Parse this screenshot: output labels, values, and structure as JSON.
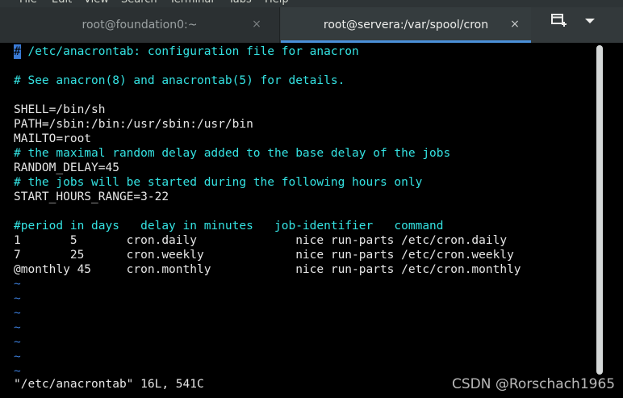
{
  "menu": {
    "items": [
      "File",
      "Edit",
      "View",
      "Search",
      "Terminal",
      "Tabs",
      "Help"
    ]
  },
  "tabs": [
    {
      "label": "root@foundation0:~",
      "active": false
    },
    {
      "label": "root@servera:/var/spool/cron",
      "active": true
    }
  ],
  "icons": {
    "tab_close": "×",
    "new_tab": "new-tab-icon",
    "menu": "chevron-down-icon"
  },
  "terminal": {
    "lines": [
      {
        "text": "# /etc/anacrontab: configuration file for anacron",
        "kind": "comment",
        "cursor_on_first_char": true
      },
      {
        "text": "",
        "kind": "normal"
      },
      {
        "text": "# See anacron(8) and anacrontab(5) for details.",
        "kind": "comment"
      },
      {
        "text": "",
        "kind": "normal"
      },
      {
        "text": "SHELL=/bin/sh",
        "kind": "normal"
      },
      {
        "text": "PATH=/sbin:/bin:/usr/sbin:/usr/bin",
        "kind": "normal"
      },
      {
        "text": "MAILTO=root",
        "kind": "normal"
      },
      {
        "text": "# the maximal random delay added to the base delay of the jobs",
        "kind": "comment"
      },
      {
        "text": "RANDOM_DELAY=45",
        "kind": "normal"
      },
      {
        "text": "# the jobs will be started during the following hours only",
        "kind": "comment"
      },
      {
        "text": "START_HOURS_RANGE=3-22",
        "kind": "normal"
      },
      {
        "text": "",
        "kind": "normal"
      },
      {
        "text": "#period in days   delay in minutes   job-identifier   command",
        "kind": "comment"
      },
      {
        "text": "1       5       cron.daily              nice run-parts /etc/cron.daily",
        "kind": "normal"
      },
      {
        "text": "7       25      cron.weekly             nice run-parts /etc/cron.weekly",
        "kind": "normal"
      },
      {
        "text": "@monthly 45     cron.monthly            nice run-parts /etc/cron.monthly",
        "kind": "normal"
      },
      {
        "text": "~",
        "kind": "tilde"
      },
      {
        "text": "~",
        "kind": "tilde"
      },
      {
        "text": "~",
        "kind": "tilde"
      },
      {
        "text": "~",
        "kind": "tilde"
      },
      {
        "text": "~",
        "kind": "tilde"
      },
      {
        "text": "~",
        "kind": "tilde"
      },
      {
        "text": "~",
        "kind": "tilde"
      }
    ],
    "status_line": "\"/etc/anacrontab\" 16L, 541C"
  },
  "watermark": "CSDN @Rorschach1965",
  "colors": {
    "comment": "#34e2e2",
    "text": "#e6e6e6",
    "tilde": "#3b7bd6",
    "active_tab_indicator": "#4a90d9",
    "background": "#000000"
  }
}
